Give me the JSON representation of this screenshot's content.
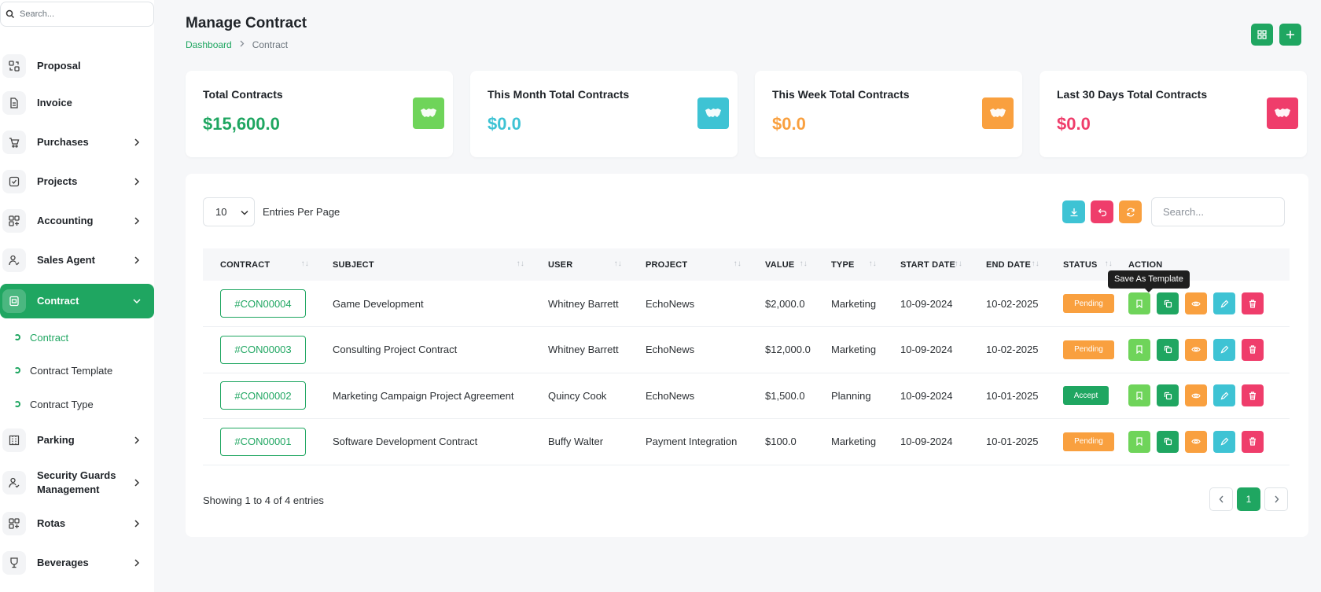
{
  "sidebar": {
    "search_placeholder": "Search...",
    "items": [
      {
        "label": "Proposal",
        "icon": "proposal-icon"
      },
      {
        "label": "Invoice",
        "icon": "invoice-icon"
      },
      {
        "label": "Purchases",
        "icon": "cart-icon"
      },
      {
        "label": "Projects",
        "icon": "check-square-icon"
      },
      {
        "label": "Accounting",
        "icon": "grid-icon"
      },
      {
        "label": "Sales Agent",
        "icon": "user-check-icon"
      },
      {
        "label": "Contract",
        "icon": "contract-icon"
      },
      {
        "label": "Parking",
        "icon": "parking-icon"
      },
      {
        "label": "Security Guards Management",
        "icon": "user-check-icon"
      },
      {
        "label": "Rotas",
        "icon": "grid-icon"
      },
      {
        "label": "Beverages",
        "icon": "glass-icon"
      }
    ],
    "subitems": [
      "Contract",
      "Contract Template",
      "Contract Type"
    ]
  },
  "header": {
    "title": "Manage Contract",
    "breadcrumb_home": "Dashboard",
    "breadcrumb_current": "Contract"
  },
  "cards": [
    {
      "title": "Total Contracts",
      "value": "$15,600.0",
      "color": "#1fa661",
      "icon_bg": "#6fd45a"
    },
    {
      "title": "This Month Total Contracts",
      "value": "$0.0",
      "color": "#3ec3d4",
      "icon_bg": "#3ec3d4"
    },
    {
      "title": "This Week Total Contracts",
      "value": "$0.0",
      "color": "#f9a03f",
      "icon_bg": "#f9a03f"
    },
    {
      "title": "Last 30 Days Total Contracts",
      "value": "$0.0",
      "color": "#ef3d6b",
      "icon_bg": "#ef3d6b"
    }
  ],
  "table": {
    "per_page_value": "10",
    "per_page_label": "Entries Per Page",
    "search_placeholder": "Search...",
    "columns": [
      "CONTRACT",
      "SUBJECT",
      "USER",
      "PROJECT",
      "VALUE",
      "TYPE",
      "START DATE",
      "END DATE",
      "STATUS",
      "ACTION"
    ],
    "rows": [
      {
        "contract": "#CON00004",
        "subject": "Game Development",
        "user": "Whitney Barrett",
        "project": "EchoNews",
        "value": "$2,000.0",
        "type": "Marketing",
        "start": "10-09-2024",
        "end": "10-02-2025",
        "status": "Pending"
      },
      {
        "contract": "#CON00003",
        "subject": "Consulting Project Contract",
        "user": "Whitney Barrett",
        "project": "EchoNews",
        "value": "$12,000.0",
        "type": "Marketing",
        "start": "10-09-2024",
        "end": "10-02-2025",
        "status": "Pending"
      },
      {
        "contract": "#CON00002",
        "subject": "Marketing Campaign Project Agreement",
        "user": "Quincy Cook",
        "project": "EchoNews",
        "value": "$1,500.0",
        "type": "Planning",
        "start": "10-09-2024",
        "end": "10-01-2025",
        "status": "Accept"
      },
      {
        "contract": "#CON00001",
        "subject": "Software Development Contract",
        "user": "Buffy Walter",
        "project": "Payment Integration",
        "value": "$100.0",
        "type": "Marketing",
        "start": "10-09-2024",
        "end": "10-01-2025",
        "status": "Pending"
      }
    ],
    "tooltip": "Save As Template",
    "showing": "Showing 1 to 4 of 4 entries",
    "current_page": "1"
  }
}
